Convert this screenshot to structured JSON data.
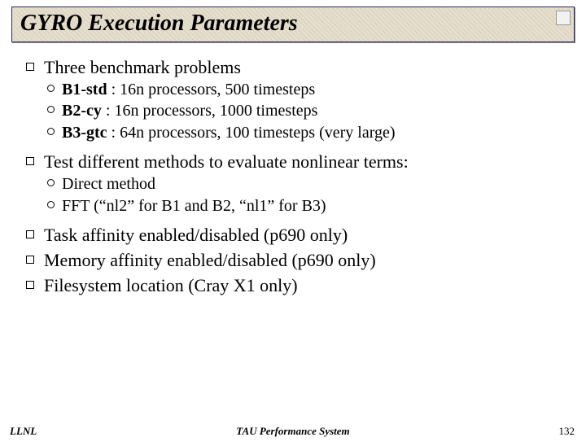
{
  "title": "GYRO Execution Parameters",
  "corner": "",
  "bullets": {
    "b1": {
      "text": "Three benchmark problems",
      "sub": [
        {
          "bold": "B1-std",
          "rest": " : 16n processors, 500 timesteps"
        },
        {
          "bold": "B2-cy",
          "rest": "  : 16n processors, 1000 timesteps"
        },
        {
          "bold": "B3-gtc",
          "rest": " : 64n processors, 100 timesteps (very large)"
        }
      ]
    },
    "b2": {
      "text": "Test different methods to evaluate nonlinear terms:",
      "sub": [
        {
          "bold": "",
          "rest": "Direct method"
        },
        {
          "bold": "",
          "rest": "FFT (“nl2” for B1 and B2, “nl1” for B3)"
        }
      ]
    },
    "b3": {
      "text": "Task affinity enabled/disabled (p690 only)"
    },
    "b4": {
      "text": "Memory affinity enabled/disabled (p690 only)"
    },
    "b5": {
      "text": "Filesystem location (Cray X1 only)"
    }
  },
  "footer": {
    "left": "LLNL",
    "center": "TAU Performance System",
    "right": "132"
  }
}
